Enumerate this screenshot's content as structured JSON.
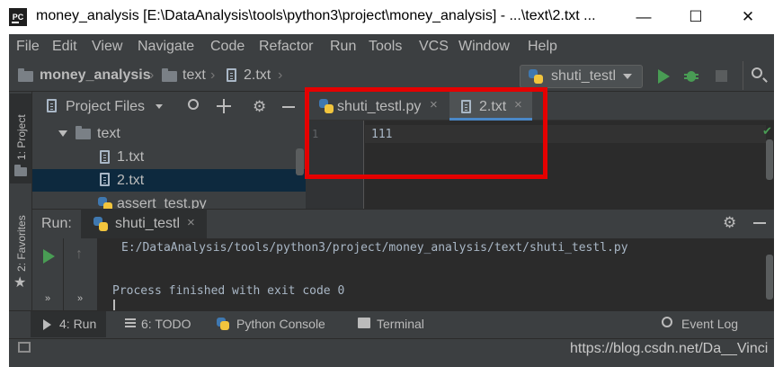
{
  "window": {
    "title": "money_analysis [E:\\DataAnalysis\\tools\\python3\\project\\money_analysis] - ...\\text\\2.txt ...",
    "app_icon": "PC",
    "minimize": "—",
    "maximize": "☐",
    "close": "✕"
  },
  "menu": [
    "File",
    "Edit",
    "View",
    "Navigate",
    "Code",
    "Refactor",
    "Run",
    "Tools",
    "VCS",
    "Window",
    "Help"
  ],
  "breadcrumb": {
    "project": "money_analysis",
    "folder": "text",
    "file": "2.txt"
  },
  "run_config": {
    "selected": "shuti_testl"
  },
  "left_stripe": {
    "project": "1: Project",
    "favorites": "2: Favorites"
  },
  "project_panel": {
    "title": "Project Files",
    "tree": [
      {
        "label": "text",
        "type": "folder"
      },
      {
        "label": "1.txt",
        "type": "file"
      },
      {
        "label": "2.txt",
        "type": "file",
        "selected": true
      },
      {
        "label": "assert_test.py",
        "type": "python"
      }
    ]
  },
  "editor": {
    "tabs": [
      {
        "label": "shuti_testl.py",
        "active": false
      },
      {
        "label": "2.txt",
        "active": true
      }
    ],
    "lines": [
      {
        "number": "1",
        "text": "111"
      }
    ]
  },
  "run_panel": {
    "label": "Run:",
    "tab": "shuti_testl",
    "console": [
      "E:/DataAnalysis/tools/python3/project/money_analysis/text/shuti_testl.py",
      "",
      "Process finished with exit code 0"
    ]
  },
  "bottom_tools": {
    "run": "4: Run",
    "todo": "6: TODO",
    "python_console": "Python Console",
    "terminal": "Terminal",
    "event_log": "Event Log"
  },
  "status_bar": {
    "watermark": "https://blog.csdn.net/Da__Vinci"
  },
  "colors": {
    "highlight": "#e50000",
    "ide_bg": "#3c3f41",
    "editor_bg": "#2b2b2b",
    "run_green": "#499c54"
  }
}
